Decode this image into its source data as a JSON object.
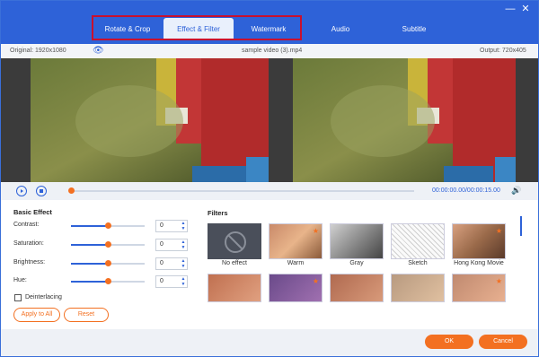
{
  "window": {
    "tabs": [
      {
        "label": "Rotate & Crop"
      },
      {
        "label": "Effect & Filter"
      },
      {
        "label": "Watermark"
      },
      {
        "label": "Audio"
      },
      {
        "label": "Subtitle"
      }
    ],
    "active_tab": "Effect & Filter",
    "minimize_icon": "minimize-icon",
    "close_icon": "close-icon"
  },
  "info": {
    "original": "Original: 1920x1080",
    "filename": "sample video (3).mp4",
    "output": "Output: 720x405"
  },
  "controls": {
    "time": "00:00:00.00/00:00:15.00",
    "progress": 0
  },
  "basic_effect": {
    "title": "Basic Effect",
    "sliders": [
      {
        "label": "Contrast:",
        "value": "0",
        "level": 0.5
      },
      {
        "label": "Saturation:",
        "value": "0",
        "level": 0.5
      },
      {
        "label": "Brightness:",
        "value": "0",
        "level": 0.5
      },
      {
        "label": "Hue:",
        "value": "0",
        "level": 0.5
      }
    ],
    "deinterlacing": "Deinterlacing",
    "apply_to_all": "Apply to All",
    "reset": "Reset"
  },
  "filters": {
    "title": "Filters",
    "items": [
      {
        "label": "No effect"
      },
      {
        "label": "Warm"
      },
      {
        "label": "Gray"
      },
      {
        "label": "Sketch"
      },
      {
        "label": "Hong Kong Movie"
      }
    ]
  },
  "footer": {
    "ok": "OK",
    "cancel": "Cancel"
  },
  "colors": {
    "accent_blue": "#2e62d8",
    "accent_orange": "#f37021",
    "highlight_red": "#c8102e"
  }
}
